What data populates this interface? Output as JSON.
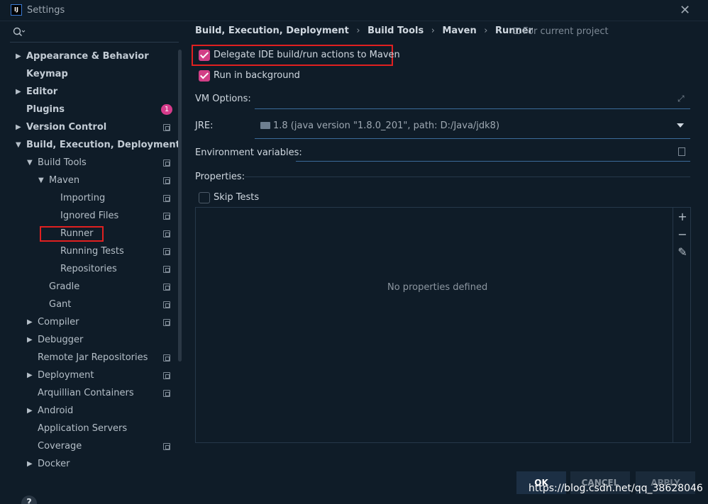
{
  "window": {
    "title": "Settings",
    "app_icon_text": "IJ"
  },
  "sidebar": {
    "search_placeholder": "",
    "items": [
      {
        "label": "Appearance & Behavior",
        "level": 0,
        "arrow": "right",
        "bold": true,
        "icon": false
      },
      {
        "label": "Keymap",
        "level": 0,
        "arrow": "",
        "bold": true,
        "icon": false
      },
      {
        "label": "Editor",
        "level": 0,
        "arrow": "right",
        "bold": true,
        "icon": false
      },
      {
        "label": "Plugins",
        "level": 0,
        "arrow": "",
        "bold": true,
        "badge": "1"
      },
      {
        "label": "Version Control",
        "level": 0,
        "arrow": "right",
        "bold": true,
        "icon": true
      },
      {
        "label": "Build, Execution, Deployment",
        "level": 0,
        "arrow": "down",
        "bold": true,
        "icon": false
      },
      {
        "label": "Build Tools",
        "level": 1,
        "arrow": "down",
        "bold": false,
        "icon": true
      },
      {
        "label": "Maven",
        "level": 2,
        "arrow": "down",
        "bold": false,
        "icon": true
      },
      {
        "label": "Importing",
        "level": 3,
        "arrow": "",
        "bold": false,
        "icon": true
      },
      {
        "label": "Ignored Files",
        "level": 3,
        "arrow": "",
        "bold": false,
        "icon": true
      },
      {
        "label": "Runner",
        "level": 3,
        "arrow": "",
        "bold": false,
        "icon": true,
        "selected": true
      },
      {
        "label": "Running Tests",
        "level": 3,
        "arrow": "",
        "bold": false,
        "icon": true
      },
      {
        "label": "Repositories",
        "level": 3,
        "arrow": "",
        "bold": false,
        "icon": true
      },
      {
        "label": "Gradle",
        "level": 2,
        "arrow": "",
        "bold": false,
        "icon": true
      },
      {
        "label": "Gant",
        "level": 2,
        "arrow": "",
        "bold": false,
        "icon": true
      },
      {
        "label": "Compiler",
        "level": 1,
        "arrow": "right",
        "bold": false,
        "icon": true
      },
      {
        "label": "Debugger",
        "level": 1,
        "arrow": "right",
        "bold": false,
        "icon": false
      },
      {
        "label": "Remote Jar Repositories",
        "level": 1,
        "arrow": "",
        "bold": false,
        "icon": true
      },
      {
        "label": "Deployment",
        "level": 1,
        "arrow": "right",
        "bold": false,
        "icon": true
      },
      {
        "label": "Arquillian Containers",
        "level": 1,
        "arrow": "",
        "bold": false,
        "icon": true
      },
      {
        "label": "Android",
        "level": 1,
        "arrow": "right",
        "bold": false,
        "icon": false
      },
      {
        "label": "Application Servers",
        "level": 1,
        "arrow": "",
        "bold": false,
        "icon": false
      },
      {
        "label": "Coverage",
        "level": 1,
        "arrow": "",
        "bold": false,
        "icon": true
      },
      {
        "label": "Docker",
        "level": 1,
        "arrow": "right",
        "bold": false,
        "icon": false
      }
    ],
    "help_label": "?"
  },
  "breadcrumb": {
    "items": [
      "Build, Execution, Deployment",
      "Build Tools",
      "Maven",
      "Runner"
    ],
    "separator": "›",
    "scope": "For current project"
  },
  "runner": {
    "delegate_label": "Delegate IDE build/run actions to Maven",
    "delegate_checked": true,
    "background_label": "Run in background",
    "background_checked": true,
    "vm_options_label": "VM Options:",
    "vm_options_value": "",
    "jre_label": "JRE:",
    "jre_value": "1.8 (java version \"1.8.0_201\", path: D:/Java/jdk8)",
    "env_label": "Environment variables:",
    "env_value": "",
    "properties_label": "Properties:",
    "skip_tests_label": "Skip Tests",
    "skip_tests_checked": false,
    "empty_properties": "No properties defined"
  },
  "buttons": {
    "ok": "OK",
    "cancel": "CANCEL",
    "apply": "APPLY"
  },
  "watermark": "https://blog.csdn.net/qq_38628046",
  "colors": {
    "accent": "#d23f86",
    "highlight_box": "#e02020",
    "background": "#0f1c28"
  }
}
